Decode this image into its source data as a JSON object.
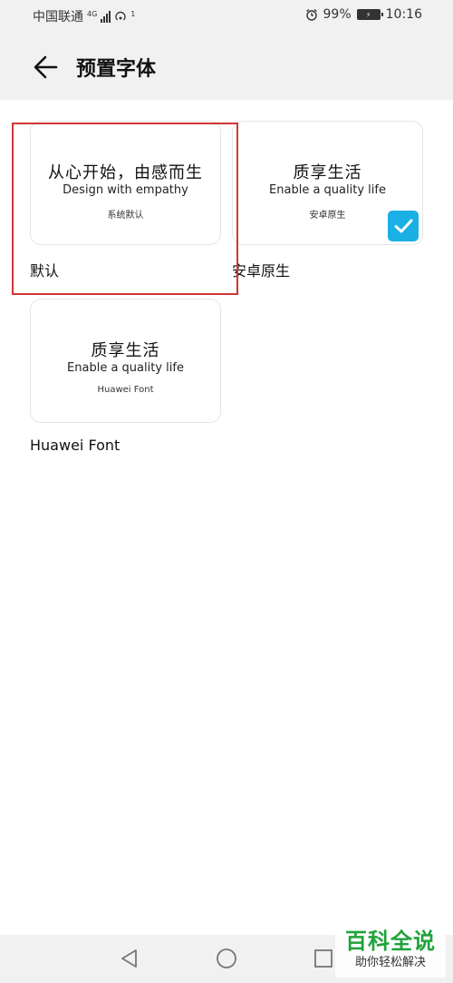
{
  "status_bar": {
    "carrier": "中国联通",
    "network": "4G",
    "hotspot_count": "1",
    "battery": "99%",
    "time": "10:16"
  },
  "header": {
    "title": "预置字体"
  },
  "fonts": [
    {
      "preview_main": "从心开始，由感而生",
      "preview_en": "Design with empathy",
      "preview_small": "系统默认",
      "label": "默认",
      "selected": false
    },
    {
      "preview_main": "质享生活",
      "preview_en": "Enable a quality life",
      "preview_small": "安卓原生",
      "label": "安卓原生",
      "selected": true
    },
    {
      "preview_main": "质享生活",
      "preview_en": "Enable a quality life",
      "preview_small": "Huawei Font",
      "label": "Huawei Font",
      "selected": false
    }
  ],
  "watermark": {
    "title": "百科全说",
    "subtitle": "助你轻松解决"
  },
  "colors": {
    "accent": "#1ab0e6",
    "highlight_box": "#d23535",
    "watermark_green": "#1fa33a"
  },
  "icons": {
    "back": "arrow-left-icon",
    "check": "check-icon",
    "nav_back": "triangle-back-icon",
    "nav_home": "circle-home-icon",
    "nav_recent": "square-recent-icon"
  }
}
